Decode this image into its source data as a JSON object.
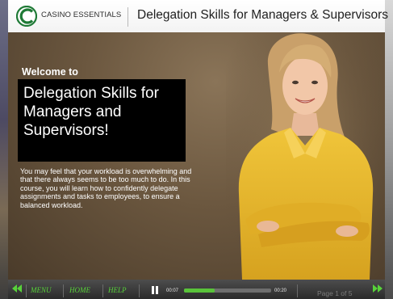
{
  "header": {
    "brand": "CASINO ESSENTIALS",
    "course_title": "Delegation Skills for Managers & Supervisors"
  },
  "slide": {
    "welcome": "Welcome to",
    "title": "Delegation Skills for Managers and Supervisors!",
    "body": "You may feel that your workload is overwhelming and that there always seems to be too much to do. In this course, you will learn how to confidently delegate assignments and tasks to employees, to ensure a balanced workload."
  },
  "controls": {
    "menu": "MENU",
    "home": "HOME",
    "help": "HELP",
    "time_current": "00:07",
    "time_total": "00:20",
    "progress": 0.35,
    "page": "Page 1 of 5"
  },
  "colors": {
    "accent_green": "#58d23a",
    "progress_green": "#59c33a",
    "shirt_yellow": "#e7b52a"
  },
  "icons": [
    "back-arrow-icon",
    "forward-arrow-icon",
    "pause-icon",
    "casino-essentials-logo"
  ]
}
